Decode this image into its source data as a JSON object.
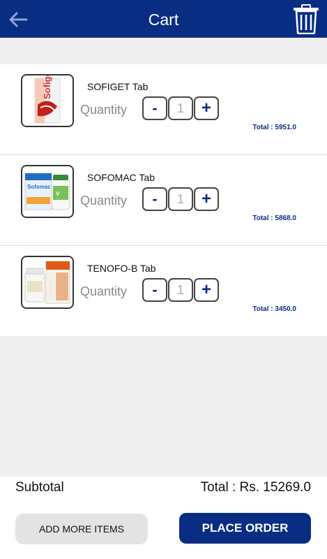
{
  "header": {
    "title": "Cart",
    "back_icon": "back-arrow-icon",
    "delete_icon": "trash-icon"
  },
  "colors": {
    "primary": "#0a2d84",
    "background": "#efefef",
    "secondary_button": "#e3e3e3"
  },
  "items": [
    {
      "name": "SOFIGET Tab",
      "quantity_label": "Quantity",
      "minus": "-",
      "quantity": "1",
      "plus": "+",
      "total": "Total : 5951.0"
    },
    {
      "name": "SOFOMAC Tab",
      "quantity_label": "Quantity",
      "minus": "-",
      "quantity": "1",
      "plus": "+",
      "total": "Total : 5868.0"
    },
    {
      "name": "TENOFO-B Tab",
      "quantity_label": "Quantity",
      "minus": "-",
      "quantity": "1",
      "plus": "+",
      "total": "Total : 3450.0"
    }
  ],
  "footer": {
    "subtotal_label": "Subtotal",
    "grand_total": "Total : Rs. 15269.0",
    "add_more_label": "ADD MORE ITEMS",
    "place_order_label": "PLACE ORDER"
  }
}
